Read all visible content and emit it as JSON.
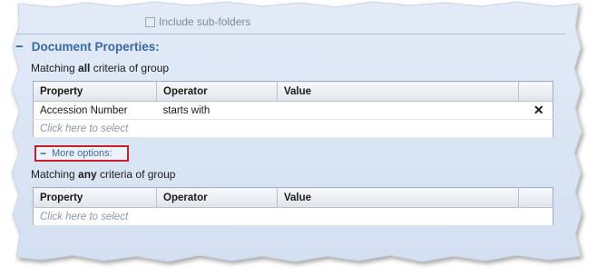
{
  "subfolders": {
    "label": "Include sub-folders"
  },
  "section": {
    "title": "Document Properties:"
  },
  "group_all": {
    "prefix": "Matching ",
    "keyword": "all",
    "suffix": " criteria of group",
    "columns": [
      "Property",
      "Operator",
      "Value"
    ],
    "rows": [
      {
        "property": "Accession Number",
        "operator": "starts with",
        "value": "",
        "remove_icon": "close-x-icon"
      }
    ],
    "placeholder_row": "Click here to select"
  },
  "more_options": {
    "label": "More options:"
  },
  "group_any": {
    "prefix": "Matching ",
    "keyword": "any",
    "suffix": " criteria of group",
    "columns": [
      "Property",
      "Operator",
      "Value"
    ],
    "placeholder_row": "Click here to select"
  },
  "colors": {
    "header_blue": "#3a67a6",
    "remove_icon": "#3a71c2",
    "highlight_box": "#c8202a",
    "panel_bg": "#d7e3f4"
  }
}
